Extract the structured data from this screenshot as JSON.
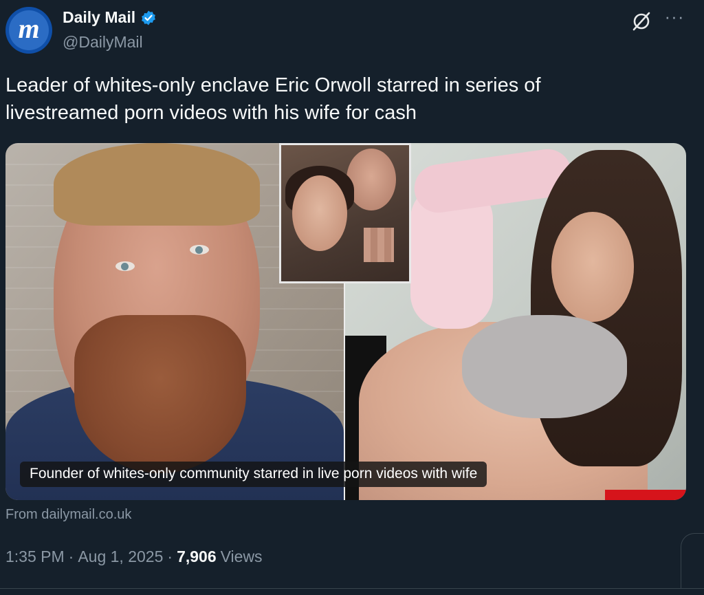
{
  "account": {
    "display_name": "Daily Mail",
    "handle": "@DailyMail",
    "avatar_mark": "m",
    "verified": true,
    "verified_color": "#1d9bf0"
  },
  "header_icons": {
    "grok": "grok-icon",
    "more": "more-icon",
    "more_glyph": "···"
  },
  "tweet": {
    "text": "Leader of whites-only enclave Eric Orwoll starred in series of livestreamed porn videos with his wife for cash"
  },
  "card": {
    "caption": "Founder of whites-only community starred in live porn videos with wife",
    "source": "From dailymail.co.uk"
  },
  "meta": {
    "time": "1:35 PM",
    "separator": "·",
    "date": "Aug 1, 2025",
    "views_count": "7,906",
    "views_label": "Views"
  },
  "colors": {
    "background": "#15202b",
    "text_primary": "#f7f9f9",
    "text_secondary": "#8b98a5",
    "border": "#38444d"
  }
}
